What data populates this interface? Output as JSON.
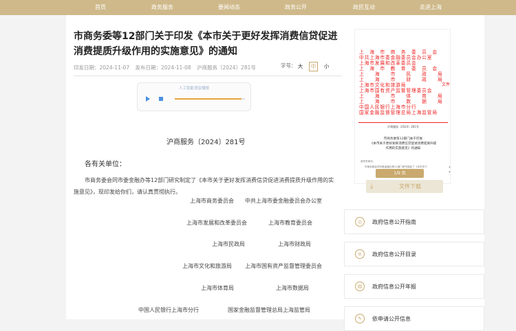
{
  "nav": [
    "首页",
    "政务服务",
    "要闻动态",
    "政务公开",
    "政民互动",
    "走进上海"
  ],
  "article": {
    "title": "市商务委等12部门关于印发《本市关于更好发挥消费信贷促进消费提质升级作用的实施意见》的通知",
    "meta": [
      "印发日期：2024-11-07",
      "发布日期：2024-11-08",
      "沪商服务〔2024〕281号"
    ],
    "font_size_label": "字号：",
    "font_sizes": [
      "大",
      "中",
      "小"
    ],
    "audio_title": "人工智能语音播报",
    "audio_progress": 0.95,
    "doc_no": "沪商服务〔2024〕281号",
    "salutation": "各有关单位：",
    "body": "市商务委会同市委金融办等12部门研究制定了《本市关于更好发挥消费信贷促进消费提质升级作用的实施意见》，现印发给你们，请认真贯彻执行。",
    "signatories": [
      [
        "上海市商务委员会",
        "中共上海市委金融委员会办公室"
      ],
      [
        "上海市发展和改革委员会",
        "上海市教育委员会"
      ],
      [
        "上海市民政局",
        "上海市财政局"
      ],
      [
        "上海市文化和旅游局",
        "上海市国有资产监督管理委员会"
      ],
      [
        "上海市体育局",
        "上海市数据局"
      ],
      [
        "中国人民银行上海市分行",
        "国家金融监督管理总局上海监管局"
      ]
    ]
  },
  "thumbnail": {
    "header_lines": [
      "上　海　市　商　务　委　员　会",
      "中共上海市委金融委员会办公室",
      "上海市发展和改革委员会",
      "上　海　市　教　育　委　员　会",
      "上　　海　　市　　民　　政　　局",
      "上　　海　　市　　财　　政　　局",
      "上海市文化和旅游局",
      "上海市国有资产监督管理委员会",
      "上　　海　　市　　体　　育　　局",
      "上　　海　　市　　数　　据　　局",
      "中国人民银行上海市分行",
      "国家金融监督管理总局上海监管局"
    ],
    "wenjian": "文件",
    "doc_no": "沪商服务〔2024〕281号",
    "doc_title": "市商务委等12部门关于印发\n《本市关于更好发挥消费信贷促进消费提质升级\n作用的实施意见》的通知",
    "small1": "各有关单位：",
    "small2": "市商务委会同市委金融办等12部门研究制定了《本市关于",
    "page_badge": "1/9 页",
    "download_label": "文件下载"
  },
  "sidebar": [
    {
      "icon": "guide-icon",
      "label": "政府信息公开指南"
    },
    {
      "icon": "catalog-icon",
      "label": "政府信息公开目录"
    },
    {
      "icon": "report-icon",
      "label": "政府信息公开年报"
    },
    {
      "icon": "apply-icon",
      "label": "依申请公开信息"
    }
  ]
}
